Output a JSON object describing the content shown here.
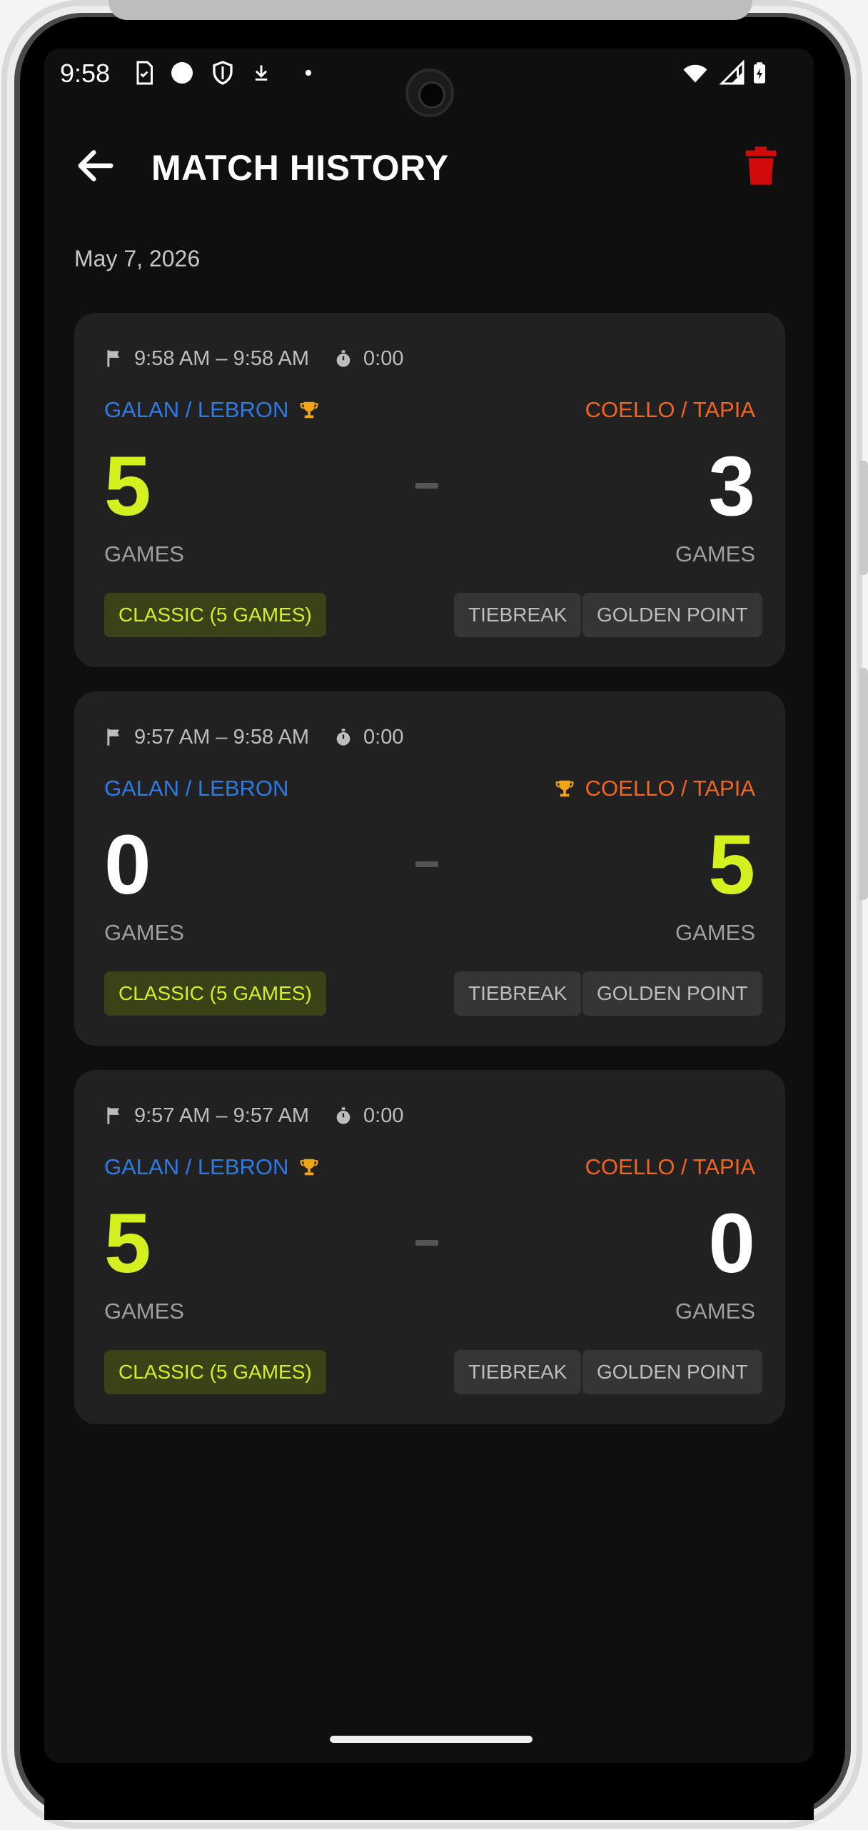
{
  "status_bar": {
    "time": "9:58",
    "left_icons": [
      "sim-icon",
      "circle-icon",
      "shield-icon",
      "download-icon",
      "dot-icon"
    ],
    "right_icons": [
      "wifi-icon",
      "signal-icon",
      "battery-icon"
    ]
  },
  "app_bar": {
    "title": "MATCH HISTORY",
    "back_icon": "arrow-left-icon",
    "delete_icon": "trash-icon",
    "delete_color": "#d10b0b"
  },
  "date_header": "May 7, 2026",
  "colors": {
    "background": "#0f0f0f",
    "card": "#212121",
    "team_a": "#2d7be6",
    "team_b": "#f4641d",
    "winner_score": "#d4f01e",
    "trophy": "#f0a516"
  },
  "matches": [
    {
      "time_range": "9:58 AM – 9:58 AM",
      "duration": "0:00",
      "team_a": "GALAN / LEBRON",
      "team_b": "COELLO / TAPIA",
      "score_a": "5",
      "score_b": "3",
      "winner": "a",
      "games_label_a": "GAMES",
      "games_label_b": "GAMES",
      "mode": "CLASSIC (5 GAMES)",
      "tiebreak": "TIEBREAK",
      "golden_point": "GOLDEN POINT"
    },
    {
      "time_range": "9:57 AM – 9:58 AM",
      "duration": "0:00",
      "team_a": "GALAN / LEBRON",
      "team_b": "COELLO / TAPIA",
      "score_a": "0",
      "score_b": "5",
      "winner": "b",
      "games_label_a": "GAMES",
      "games_label_b": "GAMES",
      "mode": "CLASSIC (5 GAMES)",
      "tiebreak": "TIEBREAK",
      "golden_point": "GOLDEN POINT"
    },
    {
      "time_range": "9:57 AM – 9:57 AM",
      "duration": "0:00",
      "team_a": "GALAN / LEBRON",
      "team_b": "COELLO / TAPIA",
      "score_a": "5",
      "score_b": "0",
      "winner": "a",
      "games_label_a": "GAMES",
      "games_label_b": "GAMES",
      "mode": "CLASSIC (5 GAMES)",
      "tiebreak": "TIEBREAK",
      "golden_point": "GOLDEN POINT"
    }
  ]
}
